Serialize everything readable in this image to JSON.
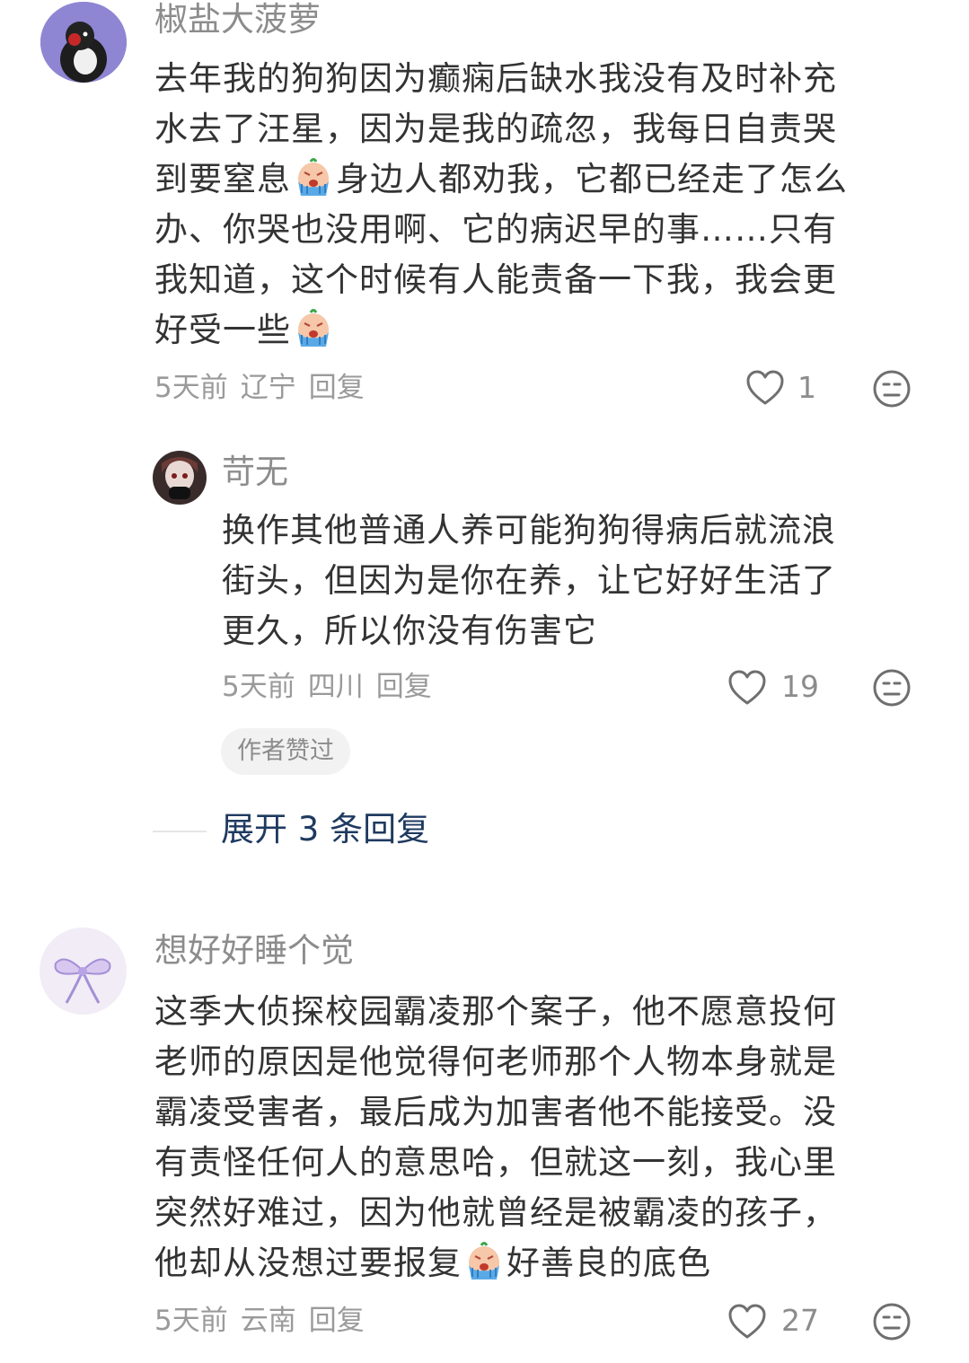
{
  "comments": [
    {
      "username": "椒盐大菠萝",
      "lines": [
        "去年我的狗狗因为癫痫后缺水我没有及时补充",
        "水去了汪星，因为是我的疏忽，我每日自责哭",
        [
          "到要窒息",
          "身边人都劝我，它都已经走了怎么"
        ],
        "办、你哭也没用啊、它的病迟早的事……只有",
        "我知道，这个时候有人能责备一下我，我会更",
        [
          "好受一些",
          ""
        ]
      ],
      "time": "5天前",
      "location": "辽宁",
      "reply_label": "回复",
      "likes": "1"
    },
    {
      "username": "苛无",
      "lines": [
        "换作其他普通人养可能狗狗得病后就流浪",
        "街头，但因为是你在养，让它好好生活了",
        "更久，所以你没有伤害它"
      ],
      "time": "5天前",
      "location": "四川",
      "reply_label": "回复",
      "likes": "19",
      "badge": "作者赞过"
    },
    {
      "username": "想好好睡个觉",
      "lines": [
        "这季大侦探校园霸凌那个案子，他不愿意投何",
        "老师的原因是他觉得何老师那个人物本身就是",
        "霸凌受害者，最后成为加害者他不能接受。没",
        "有责怪任何人的意思哈，但就这一刻，我心里",
        "突然好难过，因为他就曾经是被霸凌的孩子，",
        [
          "他却从没想过要报复",
          "好善良的底色"
        ]
      ],
      "time": "5天前",
      "location": "云南",
      "reply_label": "回复",
      "likes": "27"
    }
  ],
  "expand_replies": "展开 3 条回复",
  "icons": {
    "like": "heart-outline-icon",
    "dislike": "neutral-face-icon",
    "emoji": "crying-emoji"
  },
  "colors": {
    "username": "#8c8c8c",
    "text": "#333333",
    "meta": "#9a9a9a",
    "expand": "#1f3a60",
    "badge_bg": "#f2f2f2"
  }
}
